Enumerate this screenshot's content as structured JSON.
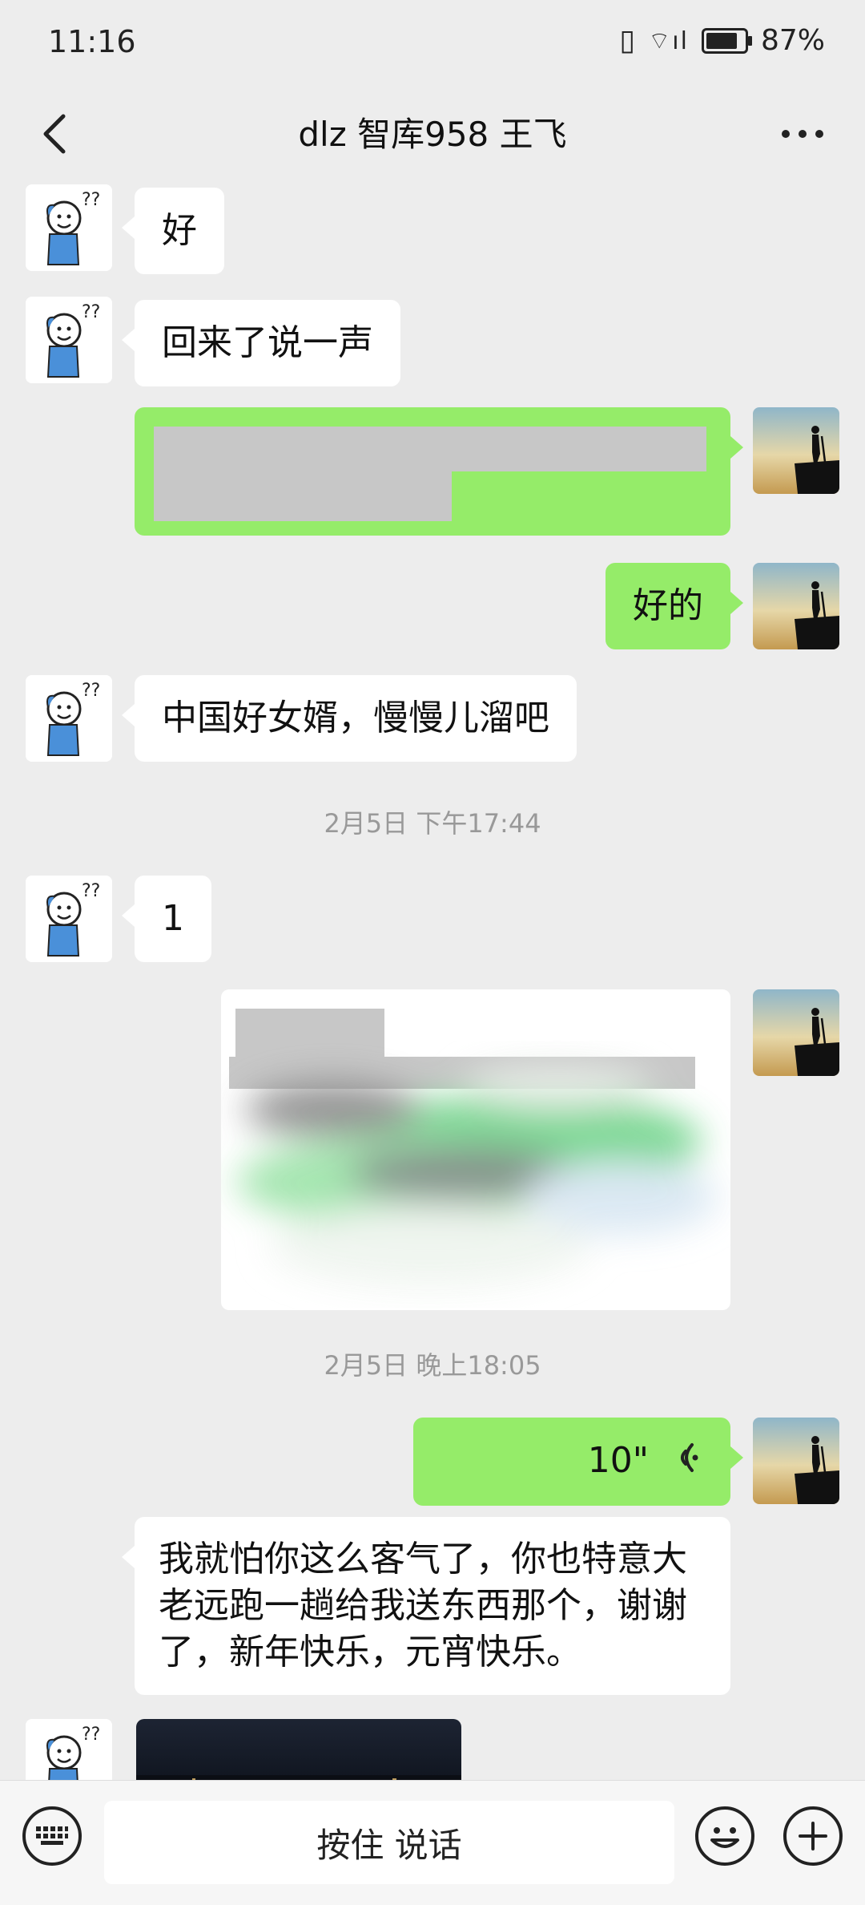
{
  "status": {
    "time": "11:16",
    "battery": "87%",
    "battery_level": 0.87
  },
  "header": {
    "title": "dlz 智库958 王飞",
    "back_icon": "back-icon",
    "more_icon": "more-icon"
  },
  "messages": [
    {
      "side": "in",
      "text": "好"
    },
    {
      "side": "in",
      "text": "回来了说一声"
    },
    {
      "side": "out",
      "text": "",
      "redacted": true
    },
    {
      "side": "out",
      "text": "好的"
    },
    {
      "side": "in",
      "text": "中国好女婿，慢慢儿溜吧"
    },
    {
      "type": "time",
      "text": "2月5日 下午17:44"
    },
    {
      "side": "in",
      "text": "1"
    },
    {
      "side": "out",
      "type": "image",
      "redacted": true
    },
    {
      "type": "time",
      "text": "2月5日 晚上18:05"
    },
    {
      "side": "out",
      "type": "voice",
      "text": "10\""
    },
    {
      "side": "in",
      "text": "我就怕你这么客气了，你也特意大老远跑一趟给我送东西那个，谢谢了，新年快乐，元宵快乐。"
    },
    {
      "side": "in",
      "type": "image"
    }
  ],
  "input": {
    "hold_to_talk": "按住 说话",
    "keyboard_icon": "keyboard-icon",
    "emoji_icon": "emoji-icon",
    "plus_icon": "plus-icon"
  },
  "colors": {
    "background": "#ededed",
    "outgoing_bubble": "#95ec69",
    "incoming_bubble": "#ffffff"
  }
}
